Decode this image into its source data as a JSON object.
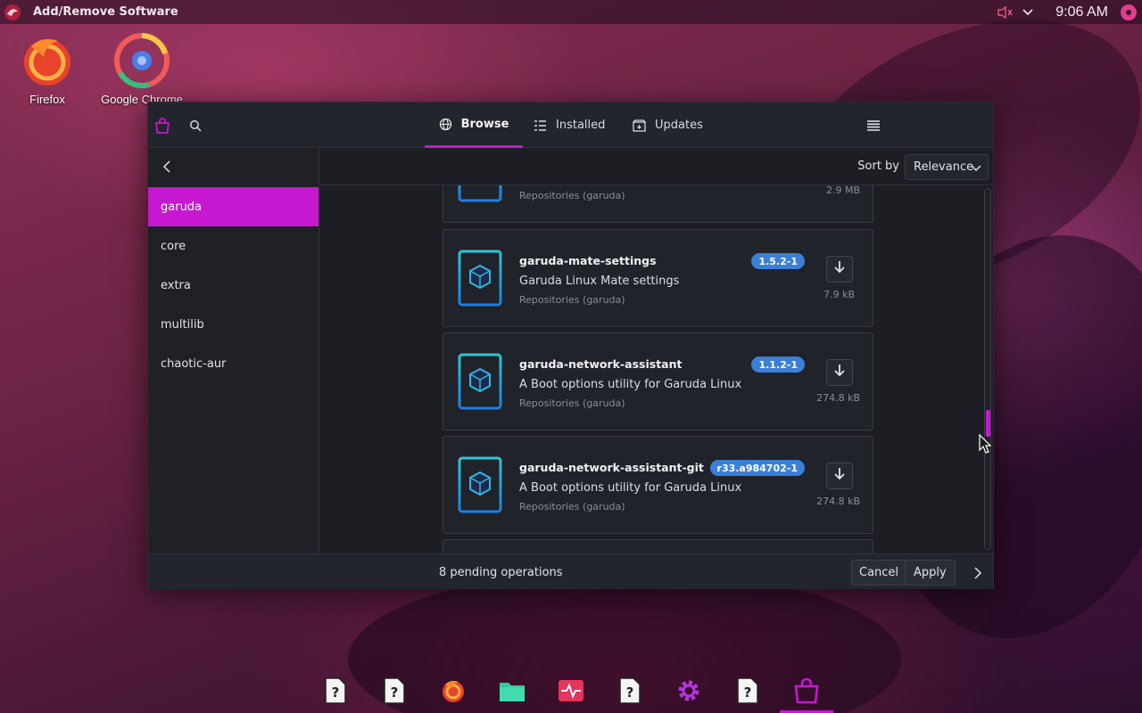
{
  "topbar": {
    "app_title": "Add/Remove Software",
    "clock": "9:06 AM",
    "icons": [
      "garuda-logo-icon",
      "volume-muted-icon",
      "chevron-down-icon",
      "user-avatar-icon"
    ]
  },
  "desktop": {
    "icons": [
      {
        "label": "Firefox",
        "icon": "firefox-icon"
      },
      {
        "label": "Google Chrome",
        "icon": "chrome-icon"
      }
    ]
  },
  "window": {
    "tabs": [
      {
        "label": "Browse",
        "icon": "globe-icon",
        "active": true
      },
      {
        "label": "Installed",
        "icon": "list-icon",
        "active": false
      },
      {
        "label": "Updates",
        "icon": "updates-icon",
        "active": false
      }
    ],
    "sidebar": {
      "items": [
        {
          "label": "garuda",
          "selected": true
        },
        {
          "label": "core",
          "selected": false
        },
        {
          "label": "extra",
          "selected": false
        },
        {
          "label": "multilib",
          "selected": false
        },
        {
          "label": "chaotic-aur",
          "selected": false
        }
      ]
    },
    "sort": {
      "label": "Sort by",
      "value": "Relevance"
    },
    "packages": [
      {
        "name": "",
        "version": "",
        "description": "",
        "repo": "Repositories (garuda)",
        "size": "2.9 MB"
      },
      {
        "name": "garuda-mate-settings",
        "version": "1.5.2-1",
        "description": "Garuda Linux Mate settings",
        "repo": "Repositories (garuda)",
        "size": "7.9 kB"
      },
      {
        "name": "garuda-network-assistant",
        "version": "1.1.2-1",
        "description": "A Boot options utility for Garuda Linux",
        "repo": "Repositories (garuda)",
        "size": "274.8 kB"
      },
      {
        "name": "garuda-network-assistant-git",
        "version": "r33.a984702-1",
        "description": "A Boot options utility for Garuda Linux",
        "repo": "Repositories (garuda)",
        "size": "274.8 kB"
      }
    ],
    "footer": {
      "pending": "8 pending operations",
      "cancel_label": "Cancel",
      "apply_label": "Apply"
    }
  },
  "dock": {
    "items": [
      "unknown-app-icon",
      "unknown-app-icon",
      "firefox-icon",
      "files-icon",
      "system-monitor-icon",
      "unknown-app-icon",
      "settings-icon",
      "unknown-app-icon",
      "software-store-icon"
    ]
  },
  "colors": {
    "accent": "#c518d0",
    "version_badge": "#3b7fd6",
    "window_bg": "#1c1e24"
  }
}
